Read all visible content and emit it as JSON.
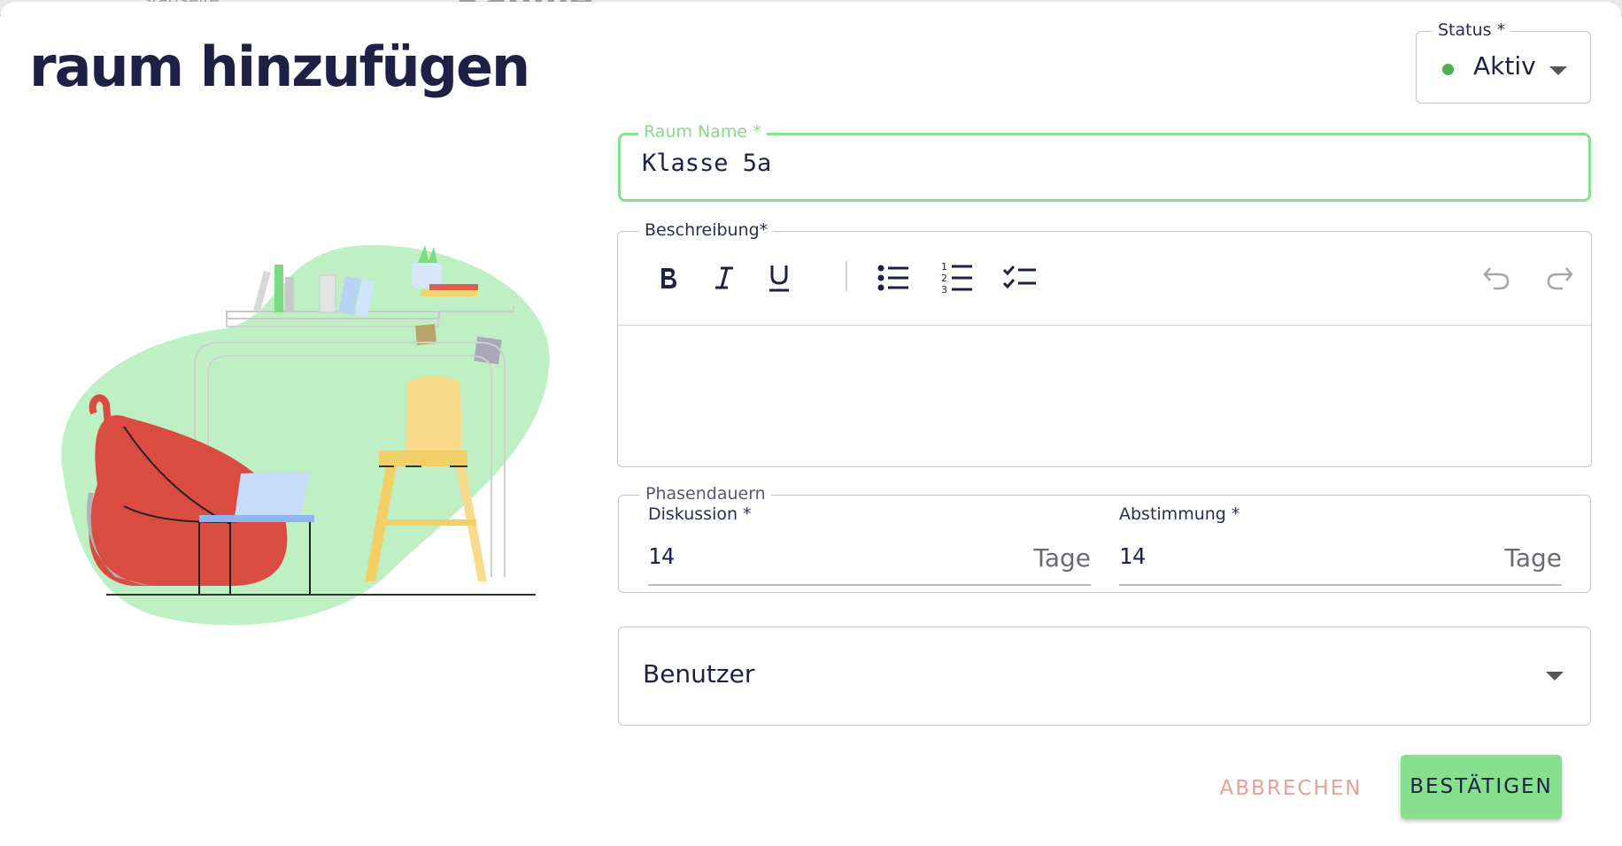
{
  "background": {
    "ghost_left": "Startseite",
    "ghost_right": "Räume"
  },
  "dialog": {
    "title": "raum hinzufügen"
  },
  "status": {
    "label": "Status *",
    "value": "Aktiv",
    "dot_color": "#4caf50"
  },
  "room_name": {
    "label": "Raum Name *",
    "value": "Klasse 5a",
    "focus_color": "#86e08e"
  },
  "description": {
    "label": "Beschreibung*",
    "value": "",
    "toolbar": [
      {
        "name": "bold-icon"
      },
      {
        "name": "italic-icon"
      },
      {
        "name": "underline-icon"
      },
      {
        "name": "bullet-list-icon"
      },
      {
        "name": "numbered-list-icon"
      },
      {
        "name": "checklist-icon"
      },
      {
        "name": "undo-icon"
      },
      {
        "name": "redo-icon"
      }
    ]
  },
  "phases": {
    "label": "Phasendauern",
    "discussion": {
      "label": "Diskussion *",
      "value": "14",
      "unit": "Tage"
    },
    "voting": {
      "label": "Abstimmung *",
      "value": "14",
      "unit": "Tage"
    }
  },
  "users": {
    "placeholder": "Benutzer"
  },
  "actions": {
    "cancel": "ABBRECHEN",
    "confirm": "BESTÄTIGEN",
    "confirm_color": "#86e08e",
    "cancel_color": "#ea9f95"
  }
}
